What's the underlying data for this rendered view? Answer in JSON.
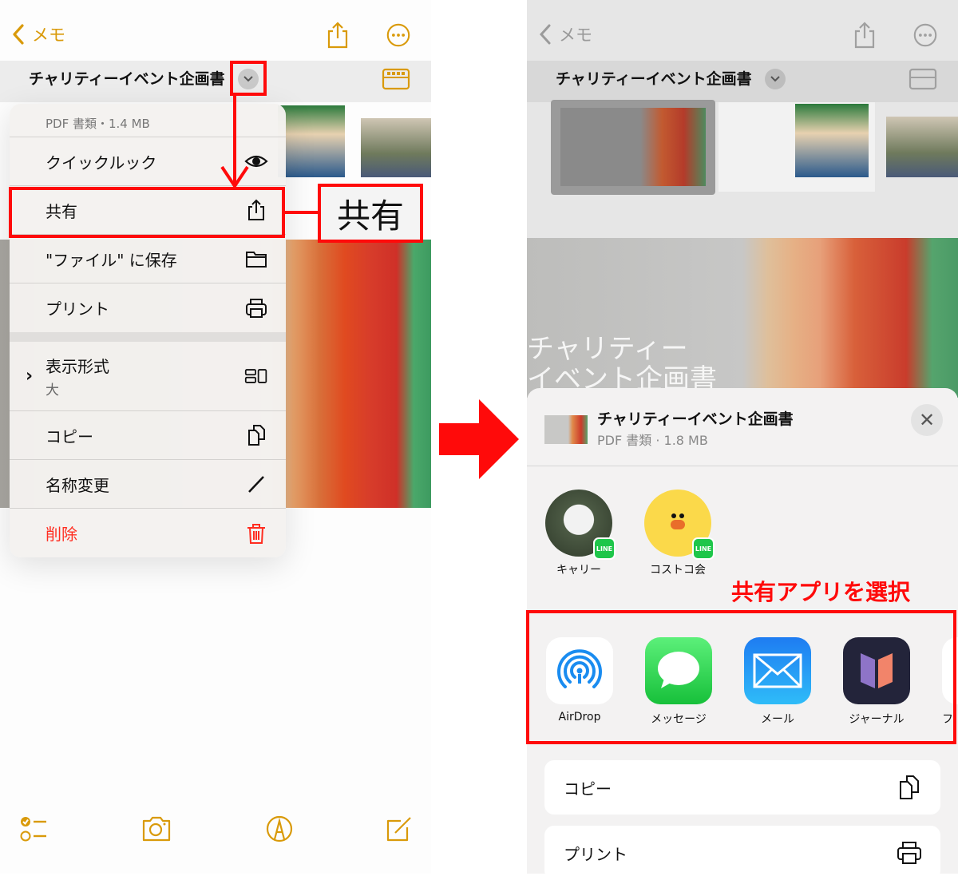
{
  "left": {
    "nav": {
      "back_label": "メモ",
      "doc_title": "チャリティーイベント企画書"
    },
    "menu": {
      "header": "PDF 書類・1.4 MB",
      "items": [
        {
          "label": "クイックルック",
          "icon": "eye-icon"
        },
        {
          "label": "共有",
          "icon": "share-icon"
        },
        {
          "label": "\"ファイル\" に保存",
          "icon": "folder-icon"
        },
        {
          "label": "プリント",
          "icon": "printer-icon"
        },
        {
          "label": "表示形式",
          "sublabel": "大",
          "icon": "layout-icon"
        },
        {
          "label": "コピー",
          "icon": "copy-icon"
        },
        {
          "label": "名称変更",
          "icon": "pencil-icon"
        },
        {
          "label": "削除",
          "icon": "trash-icon"
        }
      ]
    },
    "toolbar": [
      "checklist-icon",
      "camera-icon",
      "markup-icon",
      "compose-icon"
    ],
    "annotation": {
      "callout": "共有"
    }
  },
  "right": {
    "nav": {
      "back_label": "メモ",
      "doc_title": "チャリティーイベント企画書"
    },
    "hero_text": [
      "チャリティー",
      "イベント企画書"
    ],
    "sheet": {
      "title": "チャリティーイベント企画書",
      "subtitle": "PDF 書類 · 1.8 MB",
      "close_label": "✕",
      "contacts": [
        {
          "name": "キャリー",
          "badge": "LINE"
        },
        {
          "name": "コストコ会",
          "badge": "LINE"
        }
      ],
      "apps": [
        {
          "name": "AirDrop"
        },
        {
          "name": "メッセージ"
        },
        {
          "name": "メール"
        },
        {
          "name": "ジャーナル"
        },
        {
          "name": "フ"
        }
      ],
      "actions": [
        {
          "label": "コピー",
          "icon": "copy-icon"
        },
        {
          "label": "プリント",
          "icon": "printer-icon"
        }
      ]
    },
    "annotation": {
      "label": "共有アプリを選択"
    }
  },
  "colors": {
    "accent": "#d99a0a",
    "annotation_red": "#ff0a0a",
    "destructive": "#ff2d20"
  }
}
